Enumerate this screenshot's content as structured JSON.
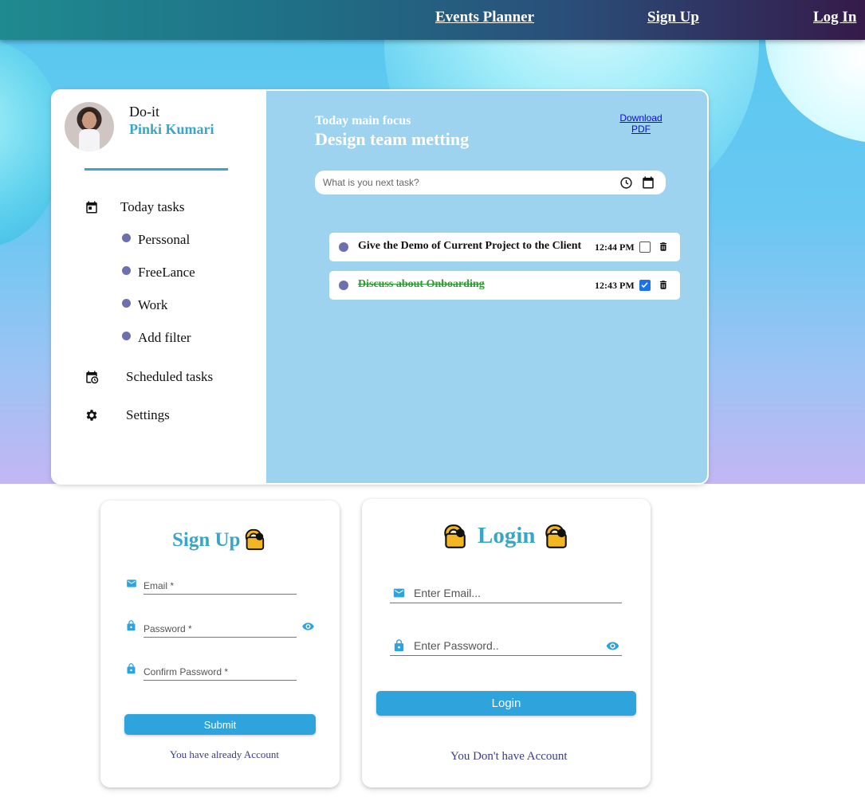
{
  "navbar": {
    "events_planner": "Events Planner",
    "sign_up": "Sign Up",
    "log_in": "Log In"
  },
  "sidebar": {
    "app_name": "Do-it",
    "user_name": "Pinki Kumari",
    "today_tasks": "Today tasks",
    "sub_items": [
      "Perssonal",
      "FreeLance",
      "Work",
      "Add filter"
    ],
    "scheduled_tasks": "Scheduled tasks",
    "settings": "Settings"
  },
  "main": {
    "focus_label": "Today main focus",
    "focus_title": "Design team metting",
    "download_pdf": "Download PDF",
    "task_input_placeholder": "What is you next task?",
    "tasks": [
      {
        "text": "Give the Demo of Current Project to the Client",
        "time": "12:44 PM",
        "done": false
      },
      {
        "text": "Discuss about Onboarding",
        "time": "12:43 PM",
        "done": true
      }
    ]
  },
  "signup": {
    "title": "Sign Up",
    "email_placeholder": "Email *",
    "password_placeholder": "Password *",
    "confirm_placeholder": "Confirm Password *",
    "submit": "Submit",
    "footer": "You have already Account"
  },
  "login": {
    "title": "Login",
    "email_placeholder": "Enter Email...",
    "password_placeholder": "Enter Password..",
    "submit": "Login",
    "footer": "You Don't have Account"
  },
  "colors": {
    "accent": "#3aa6c6",
    "button": "#2ea3dc",
    "panel": "#9ed3ef",
    "done_task": "#2e9a34"
  }
}
